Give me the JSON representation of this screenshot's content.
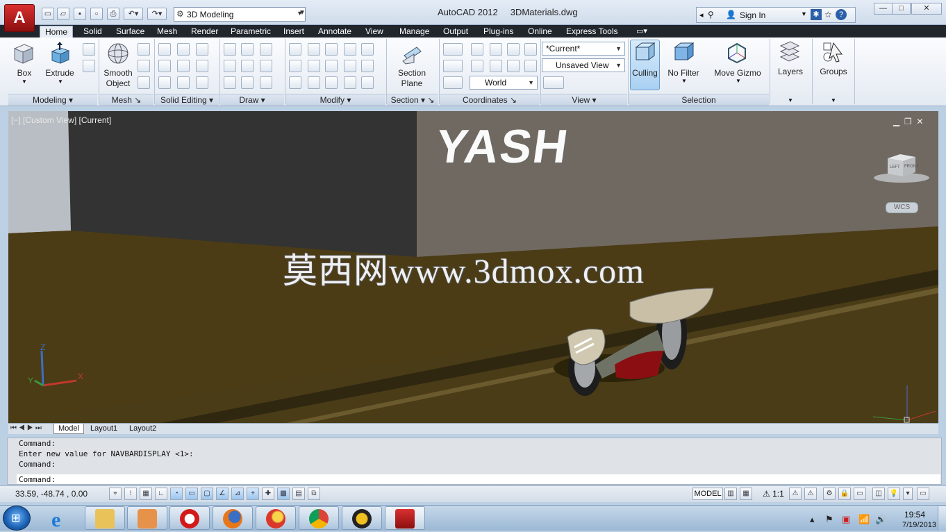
{
  "app": {
    "title": "AutoCAD 2012",
    "document": "3DMaterials.dwg",
    "logo_letter": "A",
    "workspace": "3D Modeling",
    "sign_in": "Sign In",
    "win_min": "—",
    "win_max": "□",
    "win_close": "✕"
  },
  "tabs": [
    "Home",
    "Solid",
    "Surface",
    "Mesh",
    "Render",
    "Parametric",
    "Insert",
    "Annotate",
    "View",
    "Manage",
    "Output",
    "Plug-ins",
    "Online",
    "Express Tools"
  ],
  "ribbon": {
    "modeling": {
      "box": "Box",
      "extrude": "Extrude",
      "title": "Modeling"
    },
    "mesh": {
      "smooth": "Smooth",
      "object": "Object",
      "title": "Mesh"
    },
    "solid_editing": {
      "title": "Solid Editing"
    },
    "draw": {
      "title": "Draw"
    },
    "modify": {
      "title": "Modify"
    },
    "section": {
      "label1": "Section",
      "label2": "Plane",
      "title": "Section"
    },
    "coordinates": {
      "world": "World",
      "title": "Coordinates"
    },
    "view": {
      "current": "*Current*",
      "unsaved": "Unsaved View",
      "title": "View"
    },
    "selection": {
      "culling": "Culling",
      "no_filter": "No Filter",
      "move_gizmo": "Move Gizmo",
      "title": "Selection"
    },
    "layers": "Layers",
    "groups": "Groups"
  },
  "viewport": {
    "label": "[−] [Custom View] [Current]",
    "ctrl_min": "▁",
    "ctrl_restore": "❐",
    "ctrl_close": "✕",
    "watermark": "莫西网www.3dmox.com",
    "sign_text": "YASH",
    "wcs": "WCS",
    "viewcube_left": "LEFT",
    "viewcube_front": "FRONT",
    "ucs_x": "X",
    "ucs_y": "Y",
    "ucs_z": "Z",
    "colors": {
      "floor": "#4a3c17",
      "wall_dark": "#333333",
      "wall_light": "#706a62",
      "sky": "#b9bec4"
    }
  },
  "layout_tabs": [
    "Model",
    "Layout1",
    "Layout2"
  ],
  "command": {
    "lines": [
      "Command:",
      "Enter new value for NAVBARDISPLAY <1>:",
      "Command:"
    ],
    "prompt": "Command:"
  },
  "status": {
    "coords": "33.59,   -48.74  , 0.00",
    "model": "MODEL",
    "scale": "1:1"
  },
  "taskbar": {
    "time": "19:54",
    "date": "7/19/2013",
    "apps": [
      "explorer",
      "media-player",
      "opera",
      "firefox",
      "firefox-beta",
      "chrome",
      "podcast",
      "autocad"
    ]
  }
}
